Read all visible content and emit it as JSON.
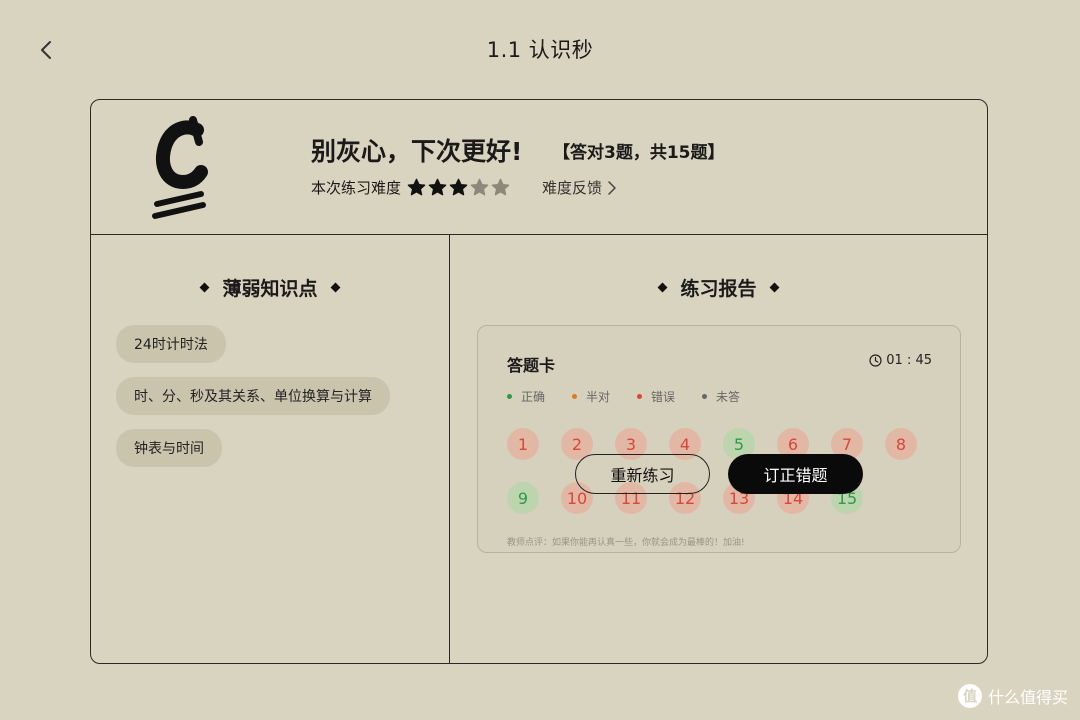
{
  "page": {
    "title": "1.1 认识秒"
  },
  "result": {
    "grade": "C",
    "message": "别灰心，下次更好!",
    "count": "【答对3题，共15题】",
    "difficulty_label": "本次练习难度",
    "difficulty_stars": 3,
    "difficulty_max": 5,
    "feedback_label": "难度反馈"
  },
  "weak_points": {
    "title": "薄弱知识点",
    "items": [
      "24时计时法",
      "时、分、秒及其关系、单位换算与计算",
      "钟表与时间"
    ]
  },
  "report": {
    "title": "练习报告",
    "card_title": "答题卡",
    "timer": "01 : 45",
    "legend": [
      {
        "label": "正确",
        "color": "#2e9a48"
      },
      {
        "label": "半对",
        "color": "#e07a1f"
      },
      {
        "label": "错误",
        "color": "#d9463a"
      },
      {
        "label": "未答",
        "color": "#666666"
      }
    ],
    "questions": [
      {
        "n": "1",
        "status": "wrong"
      },
      {
        "n": "2",
        "status": "wrong"
      },
      {
        "n": "3",
        "status": "wrong"
      },
      {
        "n": "4",
        "status": "wrong"
      },
      {
        "n": "5",
        "status": "right"
      },
      {
        "n": "6",
        "status": "wrong"
      },
      {
        "n": "7",
        "status": "wrong"
      },
      {
        "n": "8",
        "status": "wrong"
      },
      {
        "n": "9",
        "status": "right"
      },
      {
        "n": "10",
        "status": "wrong"
      },
      {
        "n": "11",
        "status": "wrong"
      },
      {
        "n": "12",
        "status": "wrong"
      },
      {
        "n": "13",
        "status": "wrong"
      },
      {
        "n": "14",
        "status": "wrong"
      },
      {
        "n": "15",
        "status": "right"
      }
    ],
    "teacher_note": "教师点评：如果你能再认真一些，你就会成为最棒的！加油!"
  },
  "actions": {
    "retry_label": "重新练习",
    "correct_label": "订正错题"
  },
  "watermark": {
    "logo": "值",
    "text": "什么值得买"
  }
}
